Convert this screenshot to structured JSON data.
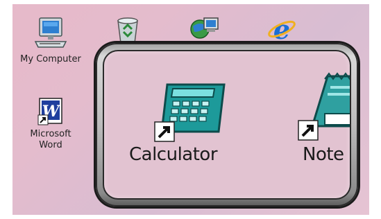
{
  "desktop": {
    "icons": [
      {
        "label": "My Computer",
        "icon": "my-computer-icon"
      },
      {
        "label": "Microsoft\nWord",
        "icon": "word-shortcut-icon"
      }
    ],
    "top_icons": [
      "recycle-bin-icon",
      "network-places-icon",
      "internet-explorer-icon"
    ]
  },
  "switcher": {
    "items": [
      {
        "label": "Calculator",
        "icon": "calculator-icon",
        "shortcut": true
      },
      {
        "label": "Note",
        "icon": "notepad-icon",
        "shortcut": true
      }
    ]
  },
  "colors": {
    "desktop_bg": "#e4bccd",
    "switcher_inner": "#e2c3d1",
    "switcher_frame": "#bcbcbc",
    "calculator_teal": "#1d9a9a"
  }
}
